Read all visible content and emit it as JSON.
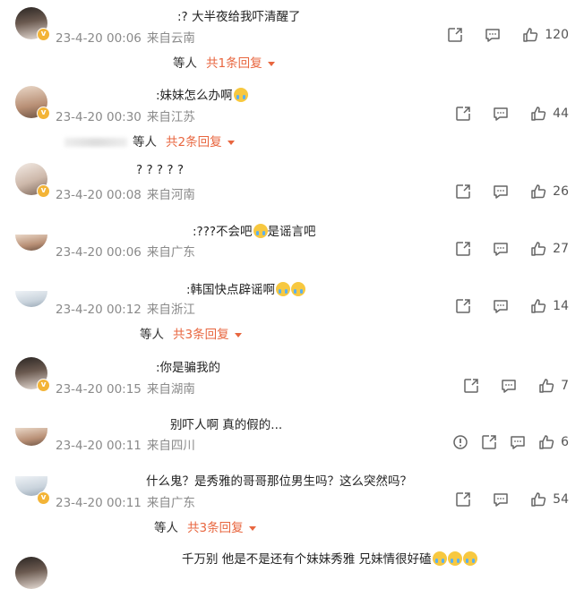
{
  "comments": [
    {
      "text": ":?  大半夜给我吓清醒了",
      "date": "23-4-20 00:06",
      "location": "来自云南",
      "likes": "120",
      "replies": {
        "who": "等人",
        "more": "共1条回复"
      }
    },
    {
      "text": ":妹妹怎么办啊",
      "date": "23-4-20 00:30",
      "location": "来自江苏",
      "likes": "44",
      "replies": {
        "who": "等人",
        "more": "共2条回复"
      }
    },
    {
      "text": "? ? ? ? ?",
      "date": "23-4-20 00:08",
      "location": "来自河南",
      "likes": "26"
    },
    {
      "text_a": ":???不会吧",
      "text_b": "是谣言吧",
      "date": "23-4-20 00:06",
      "location": "来自广东",
      "likes": "27"
    },
    {
      "text": ":韩国快点辟谣啊",
      "date": "23-4-20 00:12",
      "location": "来自浙江",
      "likes": "14",
      "replies": {
        "who": "等人",
        "more": "共3条回复"
      }
    },
    {
      "text": ":你是骗我的",
      "date": "23-4-20 00:15",
      "location": "来自湖南",
      "likes": "7"
    },
    {
      "text": "别吓人啊 真的假的...",
      "date": "23-4-20 00:11",
      "location": "来自四川",
      "likes": "6"
    },
    {
      "text": "什么鬼？是秀雅的哥哥那位男生吗？这么突然吗？",
      "date": "23-4-20 00:11",
      "location": "来自广东",
      "likes": "54",
      "replies": {
        "who": "等人",
        "more": "共3条回复"
      }
    },
    {
      "text": "千万别 他是不是还有个妹妹秀雅 兄妹情很好磕"
    }
  ],
  "badge_glyph": "v",
  "colors": {
    "accent": "#e8663f",
    "badge": "#f3b437",
    "meta": "#8a8a8a"
  },
  "icons": [
    "share-icon",
    "comment-icon",
    "like-icon",
    "report-icon"
  ]
}
